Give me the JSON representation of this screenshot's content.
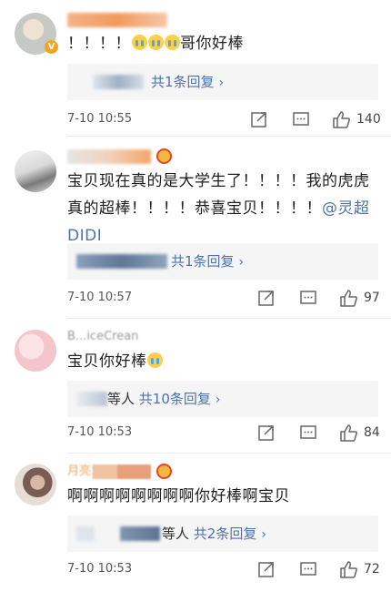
{
  "comments": [
    {
      "text": "！！！！",
      "text_tail": "哥你好棒",
      "reply_count_text": "共1条回复",
      "time": "7-10 10:55",
      "likes": "140"
    },
    {
      "text": "宝贝现在真的是大学生了！！！！我的虎虎真的超棒！！！！恭喜宝贝！！！！",
      "mention": "@灵超DIDI",
      "reply_count_text": "共1条回复",
      "time": "7-10 10:57",
      "likes": "97"
    },
    {
      "username_partial": "B...iceCrean",
      "text": "宝贝你好棒",
      "reply_prefix": "等人",
      "reply_count_text": "共10条回复",
      "time": "7-10 10:53",
      "likes": "84"
    },
    {
      "username_partial": "月亮",
      "text": "啊啊啊啊啊啊啊啊你好棒啊宝贝",
      "reply_prefix": "等人",
      "reply_count_text": "共2条回复",
      "time": "7-10 10:53",
      "likes": "72"
    }
  ],
  "icons": {
    "verified": "V",
    "reply_chevron": "›"
  },
  "colors": {
    "link": "#4a72b2",
    "reply_bg": "#f5f5f5",
    "text": "#1e1e1e",
    "meta": "#555555"
  }
}
